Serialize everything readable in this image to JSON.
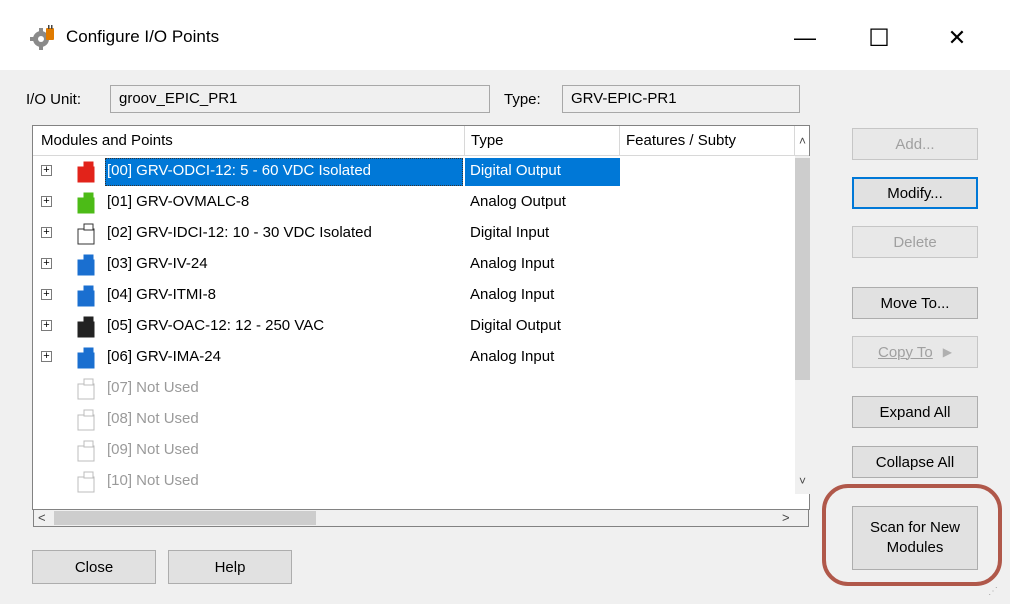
{
  "window": {
    "title": "Configure I/O Points",
    "icon": "gear-plug-icon"
  },
  "controls": {
    "minimize": "—",
    "maximize": "☐",
    "close": "✕"
  },
  "io_unit": {
    "label": "I/O Unit:",
    "value": "groov_EPIC_PR1"
  },
  "type_field": {
    "label": "Type:",
    "value": "GRV-EPIC-PR1"
  },
  "table": {
    "headers": [
      "Modules and Points",
      "Type",
      "Features / Subty"
    ],
    "rows": [
      {
        "name": "[00] GRV-ODCI-12: 5 - 60 VDC Isolated",
        "type": "Digital Output",
        "color": "#e2231a",
        "expandable": true,
        "selected": true
      },
      {
        "name": "[01] GRV-OVMALC-8",
        "type": "Analog Output",
        "color": "#4cbb17",
        "expandable": true
      },
      {
        "name": "[02] GRV-IDCI-12: 10 - 30 VDC Isolated",
        "type": "Digital Input",
        "color": "#ffffff",
        "expandable": true
      },
      {
        "name": "[03] GRV-IV-24",
        "type": "Analog Input",
        "color": "#1a6fd0",
        "expandable": true
      },
      {
        "name": "[04] GRV-ITMI-8",
        "type": "Analog Input",
        "color": "#1a6fd0",
        "expandable": true
      },
      {
        "name": "[05] GRV-OAC-12: 12 - 250 VAC",
        "type": "Digital Output",
        "color": "#222222",
        "expandable": true
      },
      {
        "name": "[06] GRV-IMA-24",
        "type": "Analog Input",
        "color": "#1a6fd0",
        "expandable": true
      },
      {
        "name": "[07] Not Used",
        "type": "",
        "color": "none",
        "expandable": false
      },
      {
        "name": "[08] Not Used",
        "type": "",
        "color": "none",
        "expandable": false
      },
      {
        "name": "[09] Not Used",
        "type": "",
        "color": "none",
        "expandable": false
      },
      {
        "name": "[10] Not Used",
        "type": "",
        "color": "none",
        "expandable": false
      }
    ]
  },
  "buttons": {
    "add": "Add...",
    "modify": "Modify...",
    "delete": "Delete",
    "move_to": "Move To...",
    "copy_to": "Copy To",
    "expand_all": "Expand All",
    "collapse_all": "Collapse All",
    "scan_line1": "Scan for New",
    "scan_line2": "Modules",
    "close": "Close",
    "help": "Help"
  }
}
